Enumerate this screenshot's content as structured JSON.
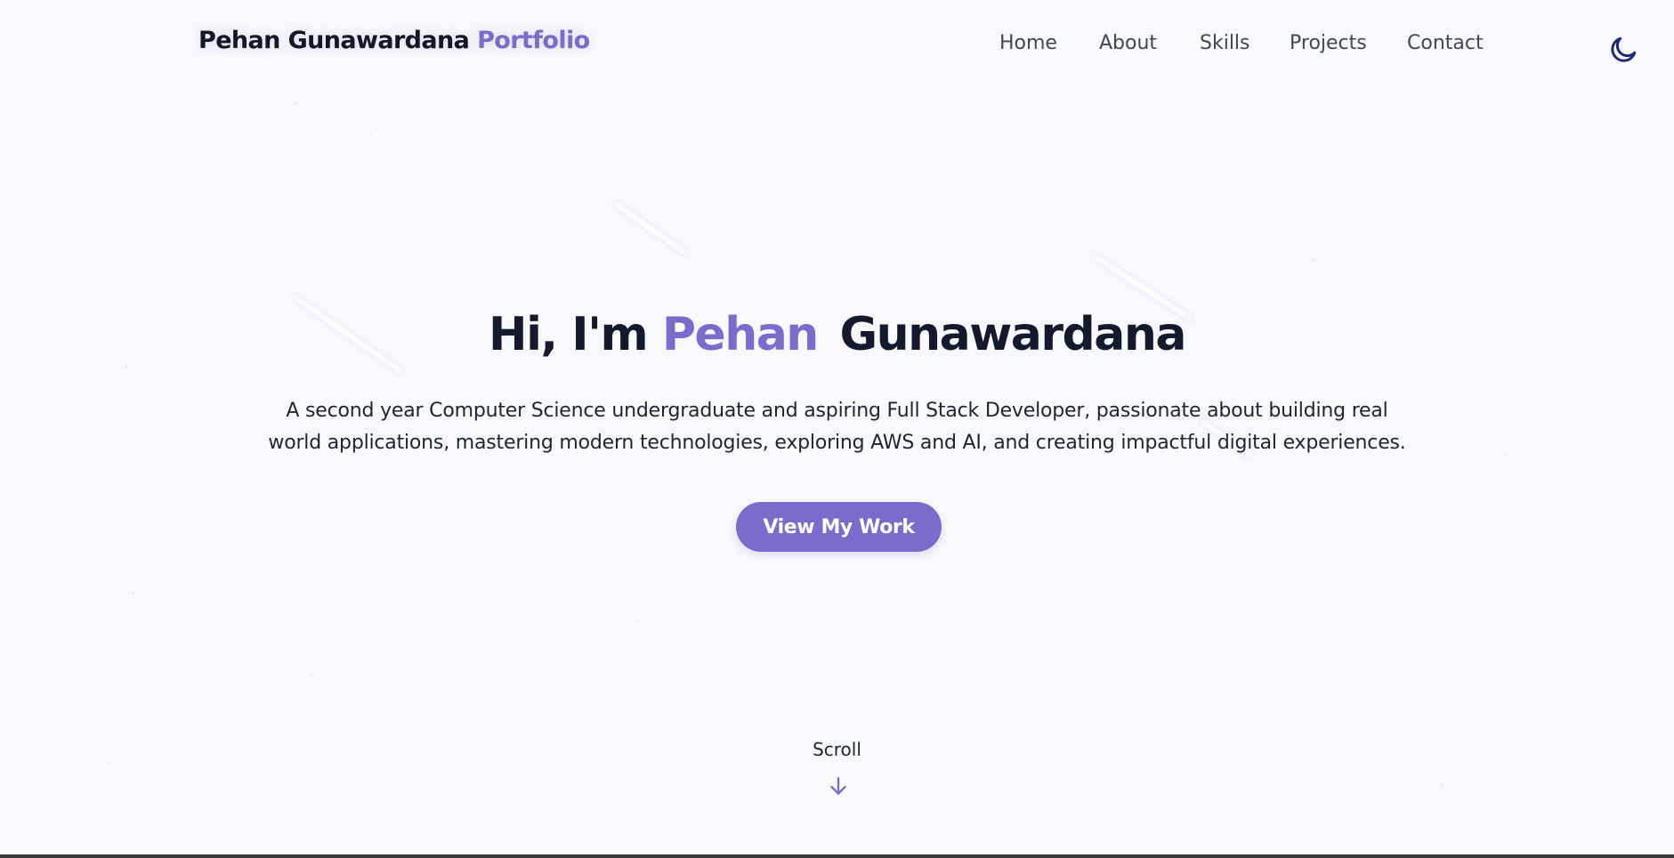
{
  "header": {
    "brand_name": "Pehan Gunawardana",
    "brand_accent": "Portfolio",
    "nav": [
      {
        "label": "Home"
      },
      {
        "label": "About"
      },
      {
        "label": "Skills"
      },
      {
        "label": "Projects"
      },
      {
        "label": "Contact"
      }
    ],
    "theme_toggle_icon": "moon-icon"
  },
  "hero": {
    "title_prefix": "Hi, I'm",
    "title_accent": "Pehan",
    "title_suffix": "Gunawardana",
    "description": "A second year Computer Science undergraduate and aspiring Full Stack Developer, passionate about building real world applications, mastering modern technologies, exploring AWS and AI, and creating impactful digital experiences.",
    "cta_label": "View My Work"
  },
  "scroll": {
    "label": "Scroll",
    "icon": "arrow-down-icon"
  },
  "colors": {
    "accent": "#7c6acc",
    "background": "#f8f9fc",
    "text_dark": "#111827",
    "nav_text": "#3f4756"
  }
}
